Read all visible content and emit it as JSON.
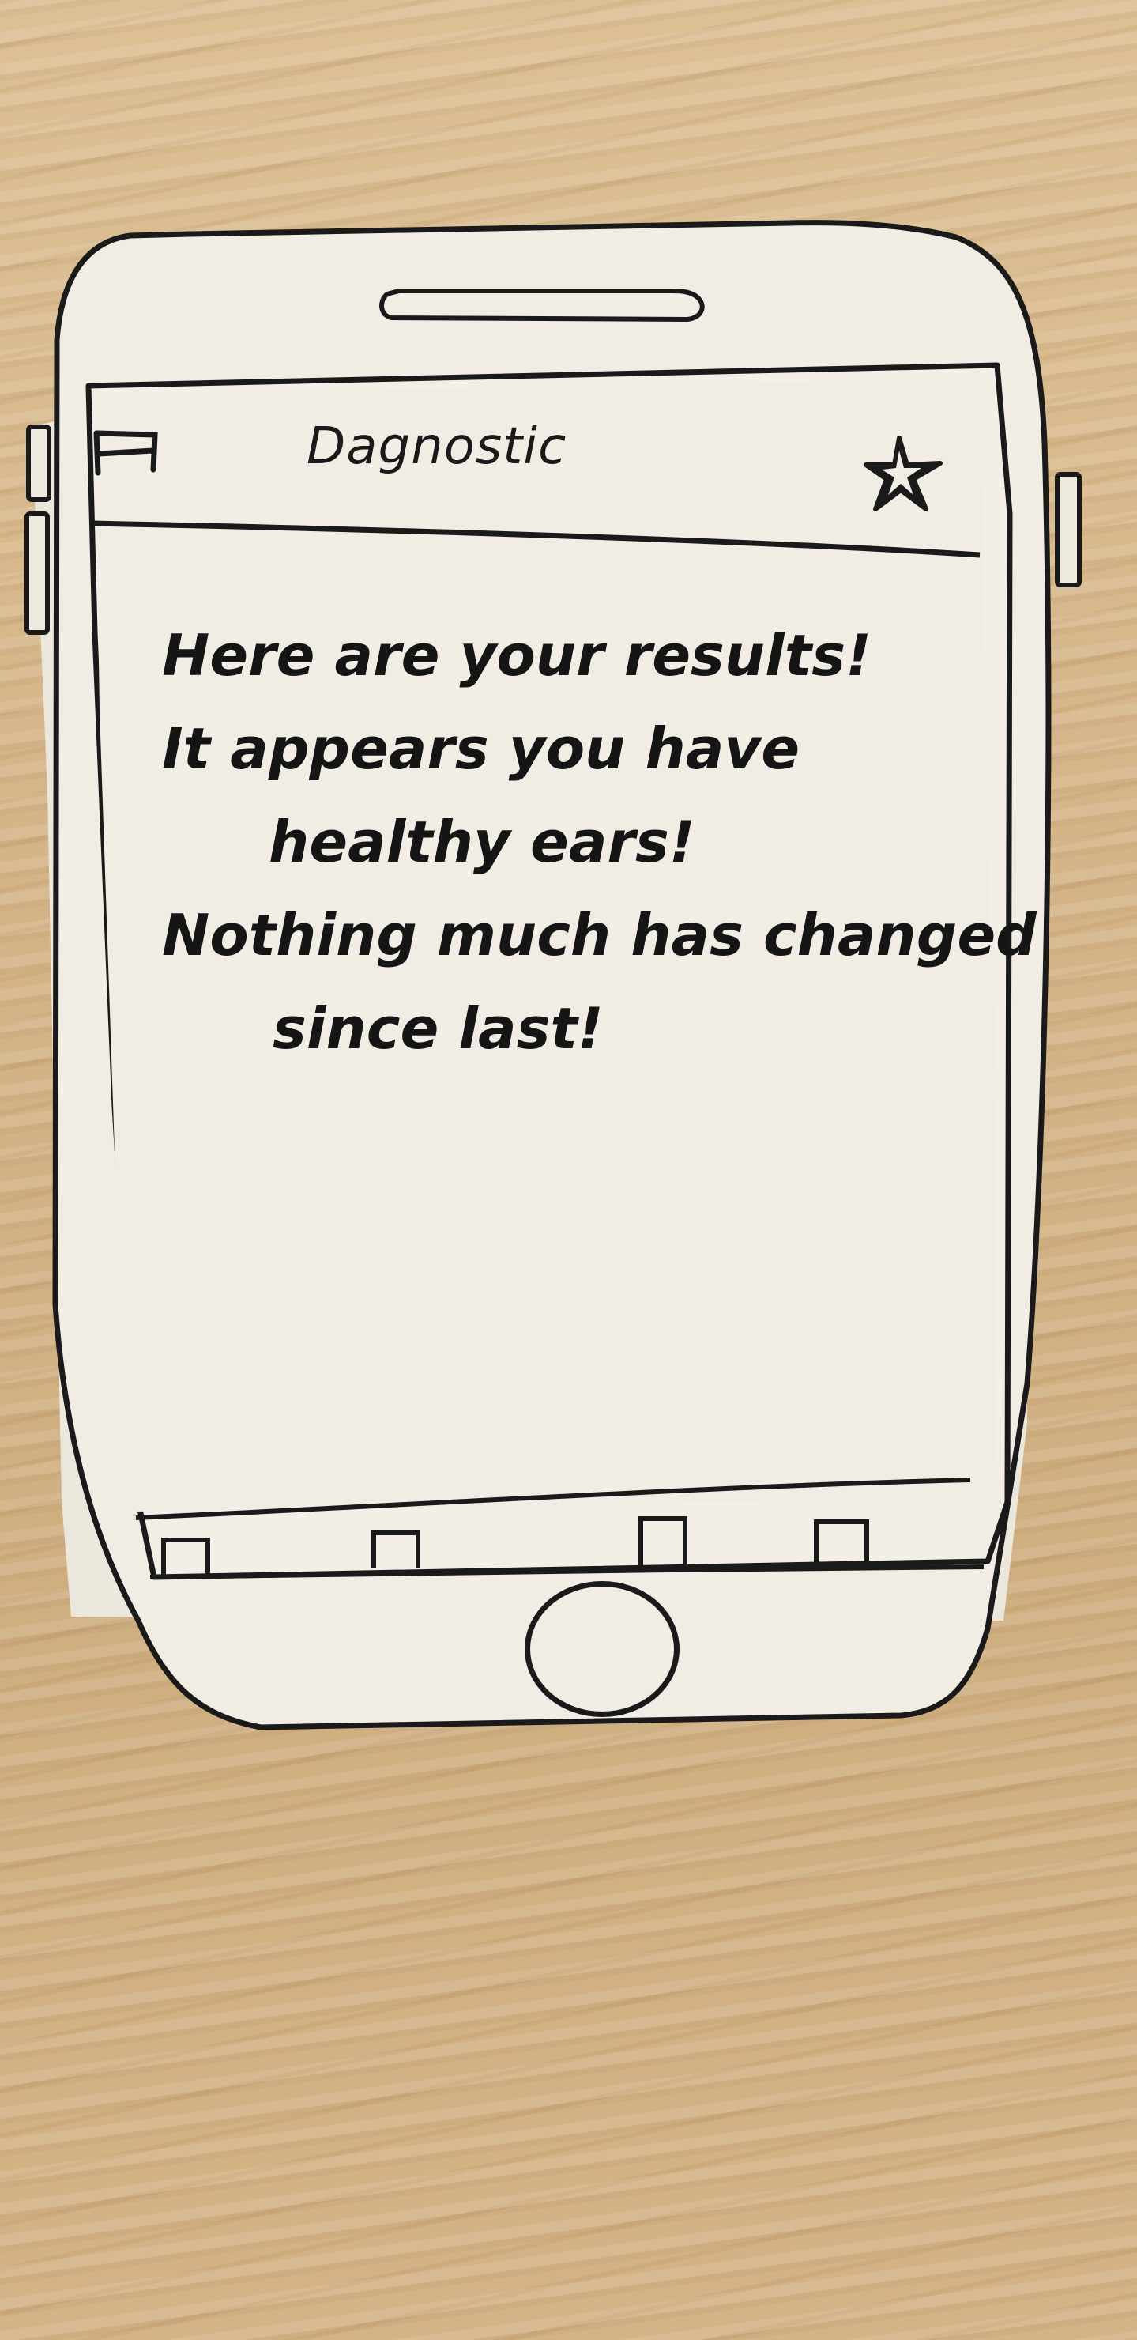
{
  "app": {
    "title": "Dagnostic"
  },
  "header": {
    "menu_icon": "menu-icon",
    "favorite_icon": "star-icon"
  },
  "main": {
    "message_lines": [
      "Here are your results!",
      "It appears you have",
      "healthy ears!",
      "Nothing much has changed",
      "since last!"
    ]
  },
  "bottom_nav": {
    "tab_count": 4
  },
  "colors": {
    "ink": "#1a1a1a",
    "paper": "#f1ede4",
    "desk": "#d8b98a"
  }
}
